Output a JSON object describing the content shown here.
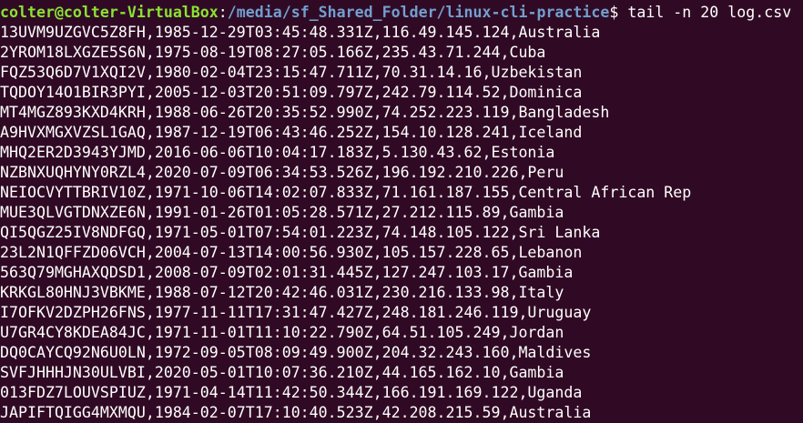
{
  "colors": {
    "background": "#300a24",
    "text": "#ffffff",
    "user_host": "#8ae234",
    "path": "#729fcf"
  },
  "prompt": {
    "user_host": "colter@colter-VirtualBox",
    "separator": ":",
    "path": "/media/sf_Shared_Folder/linux-cli-practice",
    "symbol": "$ ",
    "command": "tail -n 20 log.csv"
  },
  "output": [
    "13UVM9UZGVC5Z8FH,1985-12-29T03:45:48.331Z,116.49.145.124,Australia",
    "2YROM18LXGZE5S6N,1975-08-19T08:27:05.166Z,235.43.71.244,Cuba",
    "FQZ53Q6D7V1XQI2V,1980-02-04T23:15:47.711Z,70.31.14.16,Uzbekistan",
    "TQDOY14O1BIR3PYI,2005-12-03T20:51:09.797Z,242.79.114.52,Dominica",
    "MT4MGZ893KXD4KRH,1988-06-26T20:35:52.990Z,74.252.223.119,Bangladesh",
    "A9HVXMGXVZSL1GAQ,1987-12-19T06:43:46.252Z,154.10.128.241,Iceland",
    "MHQ2ER2D3943YJMD,2016-06-06T10:04:17.183Z,5.130.43.62,Estonia",
    "NZBNXUQHYNY0RZL4,2020-07-09T06:34:53.526Z,196.192.210.226,Peru",
    "NEIOCVYTTBRIV10Z,1971-10-06T14:02:07.833Z,71.161.187.155,Central African Rep",
    "MUE3QLVGTDNXZE6N,1991-01-26T01:05:28.571Z,27.212.115.89,Gambia",
    "QI5QGZ25IV8NDFGQ,1971-05-01T07:54:01.223Z,74.148.105.122,Sri Lanka",
    "23L2N1QFFZD06VCH,2004-07-13T14:00:56.930Z,105.157.228.65,Lebanon",
    "563Q79MGHAXQDSD1,2008-07-09T02:01:31.445Z,127.247.103.17,Gambia",
    "KRKGL80HNJ3VBKME,1988-07-12T20:42:46.031Z,230.216.133.98,Italy",
    "I7OFKV2DZPH26FNS,1977-11-11T17:31:47.427Z,248.181.246.119,Uruguay",
    "U7GR4CY8KDEA84JC,1971-11-01T11:10:22.790Z,64.51.105.249,Jordan",
    "DQ0CAYCQ92N6U0LN,1972-09-05T08:09:49.900Z,204.32.243.160,Maldives",
    "SVFJHHHJN30ULVBI,2020-05-01T10:07:36.210Z,44.165.162.10,Gambia",
    "013FDZ7LOUVSPIUZ,1971-04-14T11:42:50.344Z,166.191.169.122,Uganda",
    "JAPIFTQIGG4MXMQU,1984-02-07T17:10:40.523Z,42.208.215.59,Australia"
  ]
}
